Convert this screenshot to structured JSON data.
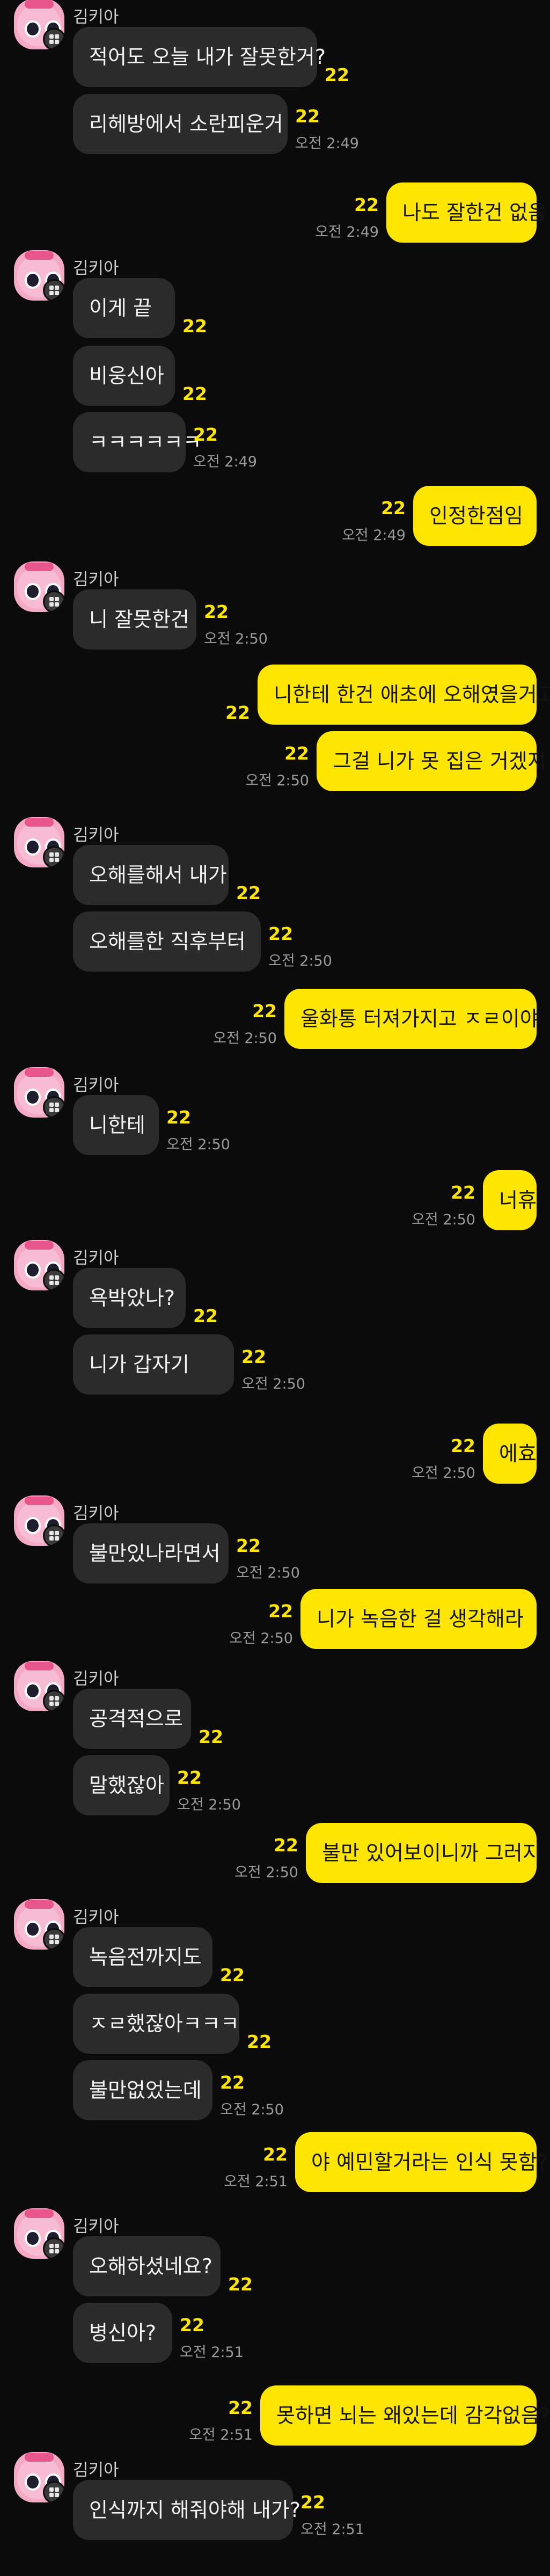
{
  "sender_name": "김키아",
  "unread_count": "22",
  "colors": {
    "background": "#0b0b0b",
    "incoming_bubble": "#2b2b2b",
    "outgoing_bubble": "#ffe600",
    "unread": "#ffe600",
    "time": "#9a9a9a"
  },
  "avatar_icon": "pink-character-avatar",
  "messages": [
    {
      "dir": "in",
      "text": "적어도 오늘 내가 잘못한거?",
      "show_sender": true,
      "time": ""
    },
    {
      "dir": "in",
      "text": "리헤방에서 소란피운거",
      "show_sender": false,
      "time": "오전 2:49"
    },
    {
      "dir": "out",
      "text": "나도 잘한건 없음",
      "time": "오전 2:49"
    },
    {
      "dir": "in",
      "text": "이게 끝",
      "show_sender": true,
      "time": ""
    },
    {
      "dir": "in",
      "text": "비웅신아",
      "show_sender": false,
      "time": ""
    },
    {
      "dir": "in",
      "text": "ㅋㅋㅋㅋㅋㅋ",
      "show_sender": false,
      "time": "오전 2:49"
    },
    {
      "dir": "out",
      "text": "인정한점임",
      "time": "오전 2:49"
    },
    {
      "dir": "in",
      "text": "니 잘못한건",
      "show_sender": true,
      "time": "오전 2:50"
    },
    {
      "dir": "out",
      "text": "니한테 한건 애초에 오해였을거고",
      "time": ""
    },
    {
      "dir": "out",
      "text": "그걸 니가 못 집은 거겠지",
      "time": "오전 2:50"
    },
    {
      "dir": "in",
      "text": "오해를해서 내가",
      "show_sender": true,
      "time": ""
    },
    {
      "dir": "in",
      "text": "오해를한 직후부터",
      "show_sender": false,
      "time": "오전 2:50"
    },
    {
      "dir": "out",
      "text": "울화통 터져가지고 ㅈㄹ이야",
      "time": "오전 2:50"
    },
    {
      "dir": "in",
      "text": "니한테",
      "show_sender": true,
      "time": "오전 2:50"
    },
    {
      "dir": "out",
      "text": "너휴",
      "time": "오전 2:50"
    },
    {
      "dir": "in",
      "text": "욕박았나?",
      "show_sender": true,
      "time": ""
    },
    {
      "dir": "in",
      "text": "니가 갑자기",
      "show_sender": false,
      "time": "오전 2:50"
    },
    {
      "dir": "out",
      "text": "에효",
      "time": "오전 2:50"
    },
    {
      "dir": "in",
      "text": "불만있나라면서",
      "show_sender": true,
      "time": "오전 2:50"
    },
    {
      "dir": "out",
      "text": "니가 녹음한 걸 생각해라",
      "time": "오전 2:50"
    },
    {
      "dir": "in",
      "text": "공격적으로",
      "show_sender": true,
      "time": ""
    },
    {
      "dir": "in",
      "text": "말했잖아",
      "show_sender": false,
      "time": "오전 2:50"
    },
    {
      "dir": "out",
      "text": "불만 있어보이니까 그러지",
      "time": "오전 2:50"
    },
    {
      "dir": "in",
      "text": "녹음전까지도",
      "show_sender": true,
      "time": ""
    },
    {
      "dir": "in",
      "text": "ㅈㄹ했잖아ㅋㅋㅋ",
      "show_sender": false,
      "time": ""
    },
    {
      "dir": "in",
      "text": "불만없었는데",
      "show_sender": false,
      "time": "오전 2:50"
    },
    {
      "dir": "out",
      "text": "야 예민할거라는 인식 못함?",
      "time": "오전 2:51"
    },
    {
      "dir": "in",
      "text": "오해하셨네요?",
      "show_sender": true,
      "time": ""
    },
    {
      "dir": "in",
      "text": "병신아?",
      "show_sender": false,
      "time": "오전 2:51"
    },
    {
      "dir": "out",
      "text": "못하면 뇌는 왜있는데 감각없음?",
      "time": "오전 2:51"
    },
    {
      "dir": "in",
      "text": "인식까지 해줘야해 내가?",
      "show_sender": true,
      "time": "오전 2:51"
    }
  ]
}
